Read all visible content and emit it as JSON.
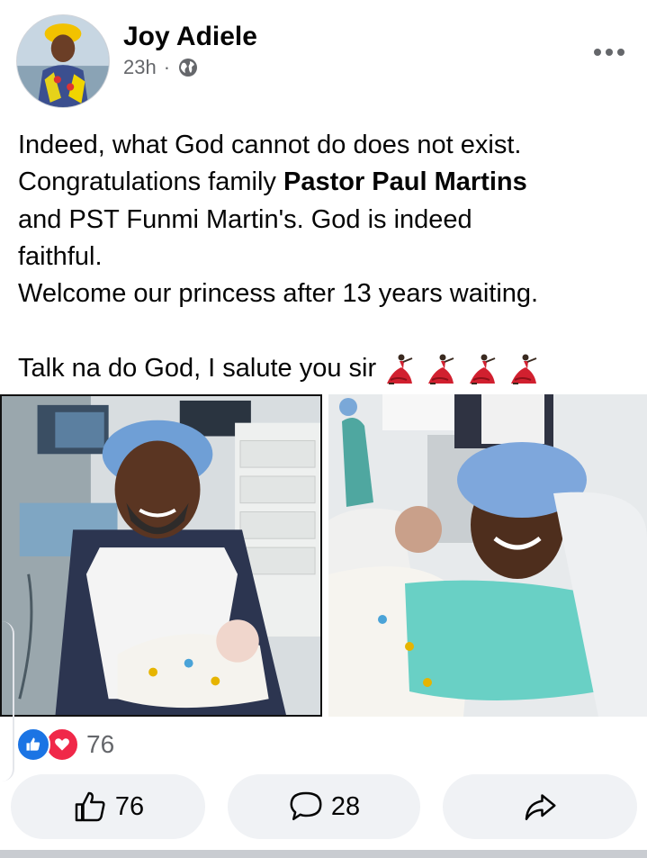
{
  "post": {
    "author": "Joy Adiele",
    "time": "23h",
    "separator": "·",
    "audience_icon": "globe-icon",
    "more_icon": "more-dots-icon",
    "text": {
      "line1": "Indeed, what God cannot do does not exist.",
      "line2_pre": "Congratulations family ",
      "line2_bold": "Pastor Paul Martins",
      "line3": "and PST Funmi Martin's. God is indeed",
      "line4": "faithful.",
      "line5": "Welcome our princess after 13 years waiting.",
      "line6": "Talk na do God, I salute you sir",
      "emoji": "dancer-emoji",
      "emoji_count": 4
    }
  },
  "photos": [
    {
      "name": "father-holding-baby-photo"
    },
    {
      "name": "mother-with-baby-photo"
    }
  ],
  "reactions": {
    "icons": [
      "like-icon",
      "love-icon"
    ],
    "count": "76"
  },
  "actions": {
    "like_count": "76",
    "comment_count": "28",
    "share_icon": "share-icon"
  },
  "colors": {
    "like_blue": "#1b74e4",
    "love_red": "#f02849",
    "muted_text": "#65676b",
    "button_bg": "#f0f2f5"
  }
}
